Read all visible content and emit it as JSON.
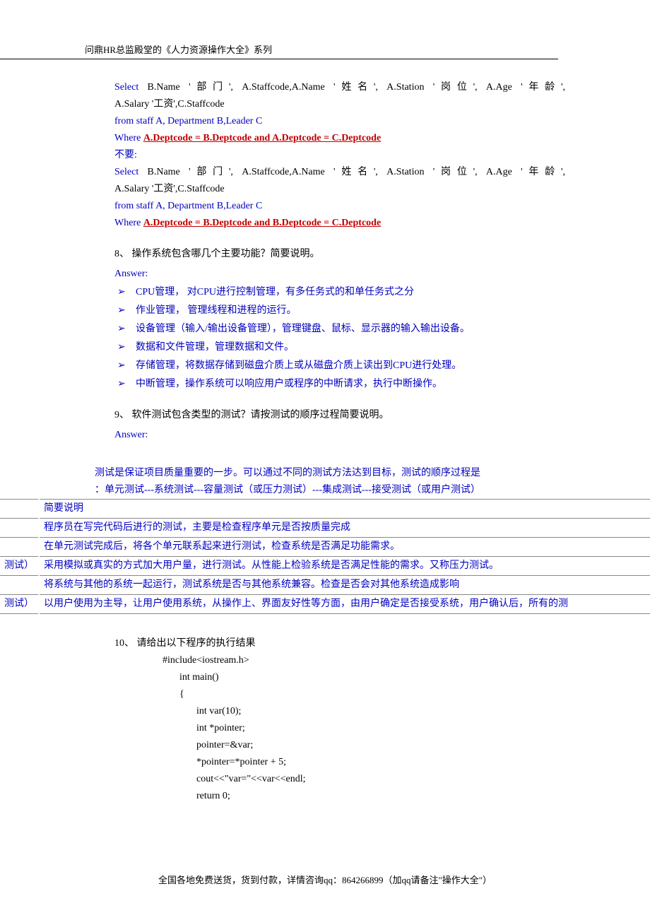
{
  "header": "问鼎HR总监殿堂的《人力资源操作大全》系列",
  "sql1": {
    "select_pre": "Select B.Name '部门', A.Staffcode,A.Name '姓名', A.Station '岗位', A.Age '年龄',",
    "select_line2": "A.Salary '工资',C.Staffcode",
    "from": "from staff A, Department B,Leader C",
    "where_kw": "Where ",
    "where_cond": "A.Deptcode = B.Deptcode and A.Deptcode = C.Deptcode"
  },
  "not": "不要:",
  "sql2": {
    "select_pre": "Select B.Name '部门', A.Staffcode,A.Name '姓名', A.Station '岗位', A.Age '年龄',",
    "select_line2": "A.Salary '工资',C.Staffcode",
    "from": "from staff A, Department B,Leader C",
    "where_kw": "Where ",
    "where_cond": "A.Deptcode = B.Deptcode and B.Deptcode = C.Deptcode"
  },
  "q8": {
    "title": "8、 操作系统包含哪几个主要功能？简要说明。",
    "answer_label": "Answer:",
    "bullets": [
      "CPU管理， 对CPU进行控制管理，有多任务式的和单任务式之分",
      "作业管理， 管理线程和进程的运行。",
      "设备管理（输入/输出设备管理），管理键盘、鼠标、显示器的输入输出设备。",
      "数据和文件管理，管理数据和文件。",
      "存储管理，将数据存储到磁盘介质上或从磁盘介质上读出到CPU进行处理。",
      "中断管理，操作系统可以响应用户或程序的中断请求，执行中断操作。"
    ]
  },
  "q9": {
    "title": "9、 软件测试包含类型的测试？请按测试的顺序过程简要说明。",
    "answer_label": "Answer:",
    "intro1": "测试是保证项目质量重要的一步。可以通过不同的测试方法达到目标，测试的顺序过程是",
    "intro2": "：单元测试---系统测试---容量测试（或压力测试）---集成测试---接受测试（或用户测试）",
    "table": {
      "header": [
        "",
        "简要说明"
      ],
      "rows": [
        [
          "",
          "程序员在写完代码后进行的测试，主要是检查程序单元是否按质量完成"
        ],
        [
          "",
          "在单元测试完成后，将各个单元联系起来进行测试，检查系统是否满足功能需求。"
        ],
        [
          "测试）",
          "采用模拟或真实的方式加大用户量，进行测试。从性能上检验系统是否满足性能的需求。又称压力测试。"
        ],
        [
          "",
          "将系统与其他的系统一起运行，测试系统是否与其他系统兼容。检查是否会对其他系统造成影响"
        ],
        [
          "测试）",
          "以用户使用为主导，让用户使用系统，从操作上、界面友好性等方面，由用户确定是否接受系统，用户确认后，所有的测"
        ]
      ]
    }
  },
  "q10": {
    "title": "10、 请给出以下程序的执行结果",
    "code": [
      {
        "ind": 1,
        "t": "#include<iostream.h>"
      },
      {
        "ind": 2,
        "t": "int main()"
      },
      {
        "ind": 2,
        "t": "{"
      },
      {
        "ind": 3,
        "t": "int var(10);"
      },
      {
        "ind": 3,
        "t": "int *pointer;"
      },
      {
        "ind": 3,
        "t": "pointer=&var;"
      },
      {
        "ind": 3,
        "t": "*pointer=*pointer + 5;"
      },
      {
        "ind": 3,
        "t": "cout<<\"var=\"<<var<<endl;"
      },
      {
        "ind": 3,
        "t": "return 0;"
      }
    ]
  },
  "footer": "全国各地免费送货，货到付款，详情咨询qq：864266899（加qq请备注\"操作大全\"）"
}
